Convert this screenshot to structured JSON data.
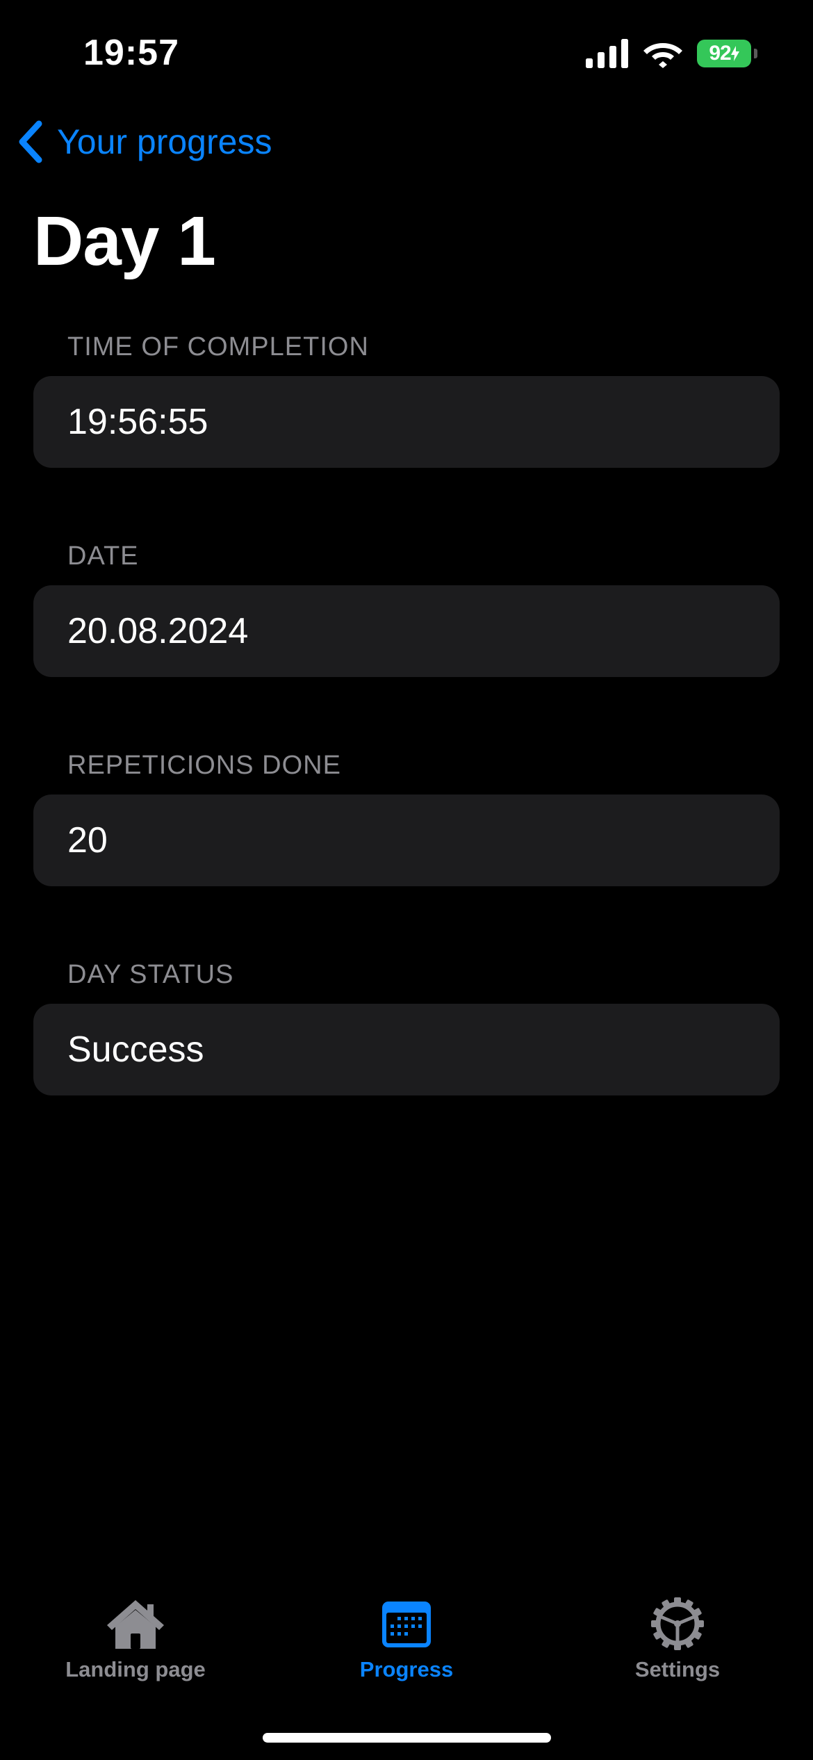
{
  "status_bar": {
    "time": "19:57",
    "battery_percent": "92",
    "battery_color": "#34c759"
  },
  "nav": {
    "back_label": "Your progress",
    "accent_color": "#0a84ff"
  },
  "page": {
    "title": "Day 1"
  },
  "fields": [
    {
      "label": "TIME OF COMPLETION",
      "value": "19:56:55"
    },
    {
      "label": "DATE",
      "value": "20.08.2024"
    },
    {
      "label": "REPETICIONS DONE",
      "value": "20"
    },
    {
      "label": "DAY STATUS",
      "value": "Success"
    }
  ],
  "tab_bar": {
    "tabs": [
      {
        "label": "Landing page",
        "icon": "house-icon",
        "active": false
      },
      {
        "label": "Progress",
        "icon": "calendar-icon",
        "active": true
      },
      {
        "label": "Settings",
        "icon": "gear-icon",
        "active": false
      }
    ]
  }
}
